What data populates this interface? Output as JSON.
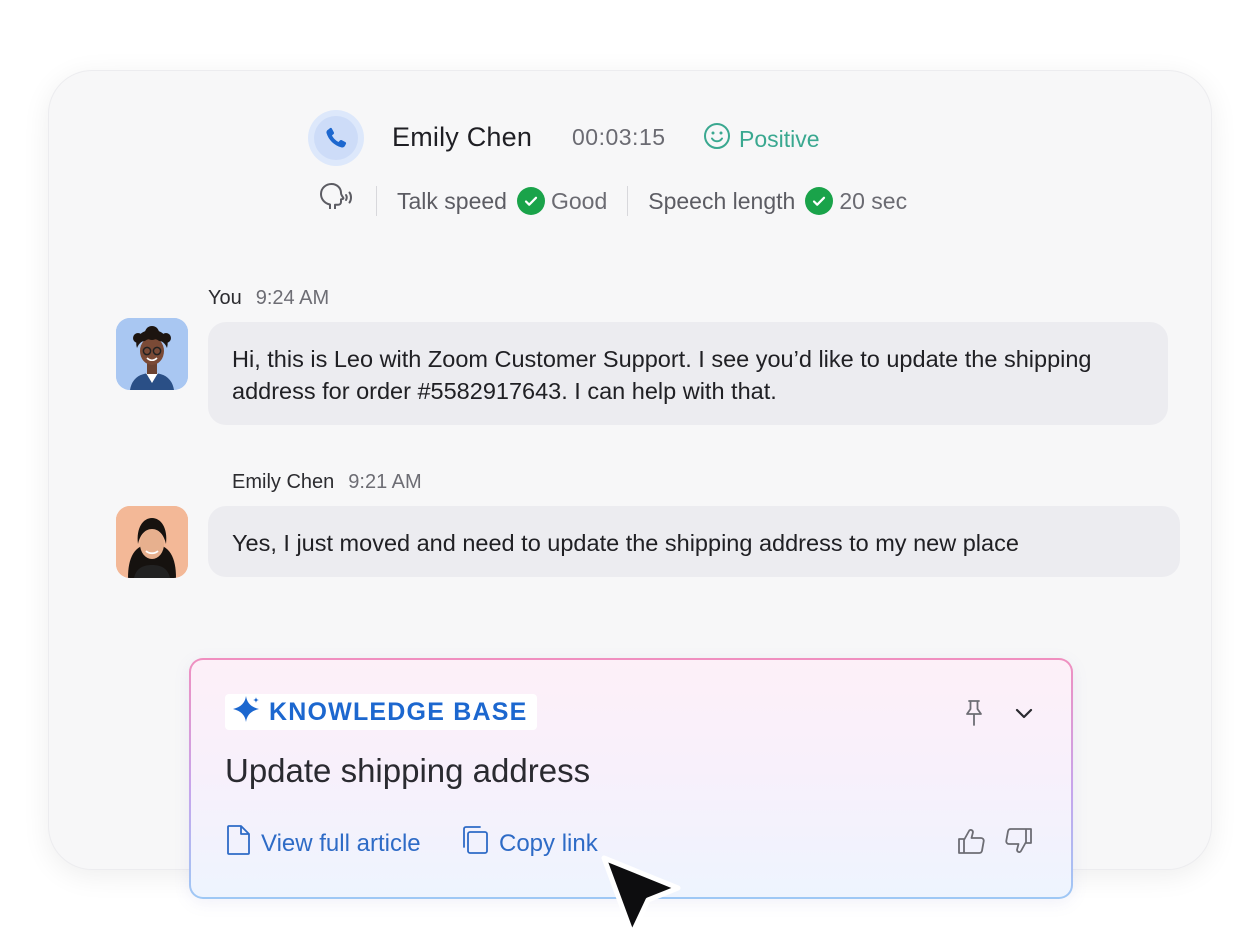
{
  "call": {
    "caller_name": "Emily Chen",
    "duration": "00:03:15",
    "sentiment": "Positive",
    "metrics": [
      {
        "label": "Talk speed",
        "value": "Good"
      },
      {
        "label": "Speech length",
        "value": "20 sec"
      }
    ]
  },
  "messages": [
    {
      "sender": "You",
      "time": "9:24 AM",
      "text": "Hi, this is Leo with Zoom Customer Support. I see you’d like to update the shipping address for order #5582917643. I can help with that."
    },
    {
      "sender": "Emily Chen",
      "time": "9:21 AM",
      "text": "Yes, I just moved and need to update the shipping address to my new place"
    }
  ],
  "knowledge_base": {
    "badge": "KNOWLEDGE BASE",
    "title": "Update shipping address",
    "view_article": "View full article",
    "copy_link": "Copy link"
  },
  "colors": {
    "accent_blue": "#1c67cf",
    "link_blue": "#2e6bc6",
    "positive_green": "#3aa890",
    "check_green": "#1aa34a"
  },
  "icons": [
    "phone-icon",
    "smiley-icon",
    "speaking-head-icon",
    "check-icon",
    "sparkle-icon",
    "pin-icon",
    "chevron-down-icon",
    "document-icon",
    "copy-icon",
    "thumbs-up-icon",
    "thumbs-down-icon",
    "cursor-arrow"
  ]
}
